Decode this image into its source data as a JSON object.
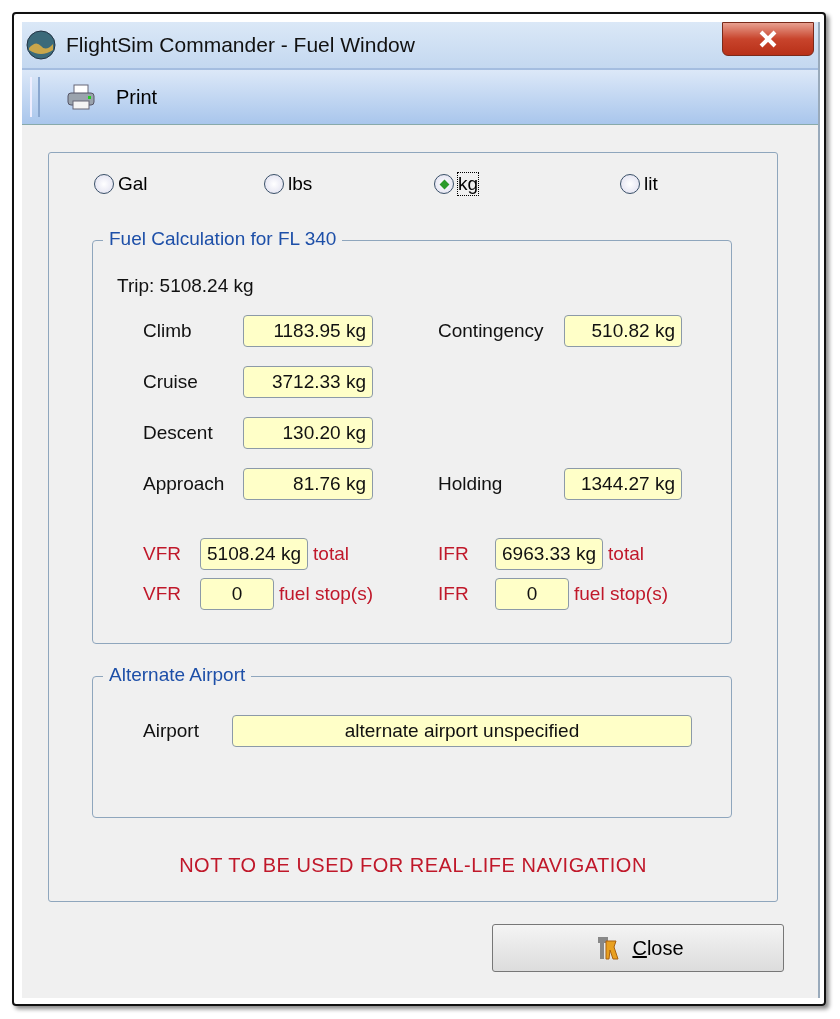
{
  "window": {
    "title": "FlightSim Commander - Fuel Window"
  },
  "toolbar": {
    "print": "Print"
  },
  "units": [
    {
      "label": "Gal",
      "selected": false
    },
    {
      "label": "lbs",
      "selected": false
    },
    {
      "label": "kg",
      "selected": true
    },
    {
      "label": "lit",
      "selected": false
    }
  ],
  "fuel_calculation": {
    "title": "Fuel Calculation for FL 340",
    "trip": "Trip: 5108.24 kg",
    "rows": [
      {
        "cells": [
          {
            "label": "Climb",
            "value": "1183.95 kg"
          },
          {
            "label": "Contingency",
            "value": "510.82 kg"
          }
        ]
      },
      {
        "cells": [
          {
            "label": "Cruise",
            "value": "3712.33 kg"
          }
        ]
      },
      {
        "cells": [
          {
            "label": "Descent",
            "value": "130.20 kg"
          }
        ]
      },
      {
        "cells": [
          {
            "label": "Approach",
            "value": "81.76 kg"
          },
          {
            "label": "Holding",
            "value": "1344.27 kg"
          }
        ]
      }
    ],
    "totals": [
      {
        "label": "VFR",
        "value": "5108.24 kg",
        "suffix": "total"
      },
      {
        "label": "IFR",
        "value": "6963.33 kg",
        "suffix": "total"
      },
      {
        "label": "VFR",
        "value": "0",
        "suffix": "fuel stop(s)"
      },
      {
        "label": "IFR",
        "value": "0",
        "suffix": "fuel stop(s)"
      }
    ]
  },
  "alternate_airport": {
    "title": "Alternate Airport",
    "label": "Airport",
    "value": "alternate airport unspecified"
  },
  "warning": "NOT TO BE USED FOR REAL-LIFE NAVIGATION",
  "close_button": "Close"
}
